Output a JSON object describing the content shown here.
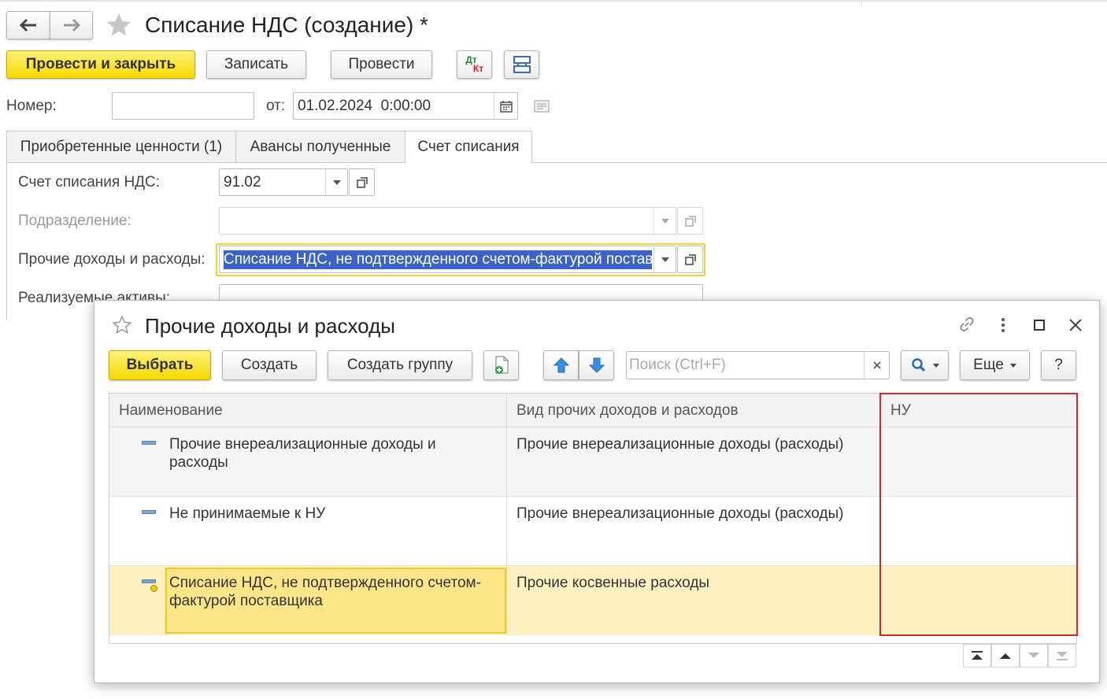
{
  "form": {
    "title": "Списание НДС (создание) *",
    "toolbar": {
      "post_close": "Провести и закрыть",
      "save": "Записать",
      "post": "Провести",
      "dt_label": "Дт",
      "kt_label": "Кт"
    },
    "number_label": "Номер:",
    "number_value": "",
    "date_label": "от:",
    "date_value": "01.02.2024  0:00:00"
  },
  "tabs": [
    {
      "label": "Приобретенные ценности (1)"
    },
    {
      "label": "Авансы полученные"
    },
    {
      "label": "Счет списания"
    }
  ],
  "fields": {
    "account_label": "Счет списания НДС:",
    "account_value": "91.02",
    "division_label": "Подразделение:",
    "division_value": "",
    "income_label": "Прочие доходы и расходы:",
    "income_value": "Списание НДС, не подтвержденного счетом-фактурой поставщика",
    "assets_label": "Реализуемые активы:"
  },
  "dialog": {
    "title": "Прочие доходы и расходы",
    "select": "Выбрать",
    "create": "Создать",
    "create_group": "Создать группу",
    "search_placeholder": "Поиск (Ctrl+F)",
    "more": "Еще",
    "help": "?",
    "columns": [
      "Наименование",
      "Вид прочих доходов и расходов",
      "НУ"
    ],
    "rows": [
      {
        "name": "Прочие внереализационные доходы и расходы",
        "kind": "Прочие внереализационные доходы (расходы)",
        "nu": ""
      },
      {
        "name": "Не принимаемые к НУ",
        "kind": "Прочие внереализационные доходы (расходы)",
        "nu": ""
      },
      {
        "name": "Списание НДС, не подтвержденного счетом-фактурой поставщика",
        "kind": "Прочие косвенные расходы",
        "nu": ""
      }
    ]
  },
  "colors": {
    "accent_yellow": "#f6d800",
    "selected_row": "#fdf1c2",
    "selected_cell": "#fde58a",
    "highlight_red": "#d9232d",
    "selection_blue": "#3b63c4"
  }
}
